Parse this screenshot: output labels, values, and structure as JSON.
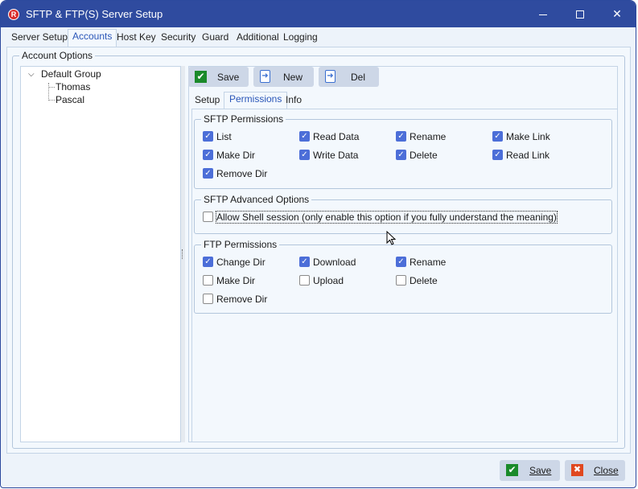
{
  "window": {
    "title": "SFTP & FTP(S) Server Setup",
    "app_icon_letter": "R",
    "controls": {
      "minimize": "",
      "maximize": "",
      "close": "✕"
    }
  },
  "tabs": [
    {
      "label": "Server Setup",
      "active": false
    },
    {
      "label": "Accounts",
      "active": true
    },
    {
      "label": "Host Key",
      "active": false
    },
    {
      "label": "Security",
      "active": false
    },
    {
      "label": "Guard",
      "active": false
    },
    {
      "label": "Additional",
      "active": false
    },
    {
      "label": "Logging",
      "active": false
    }
  ],
  "account_options": {
    "title": "Account Options",
    "tree": {
      "group": "Default Group",
      "chevron": "⌵",
      "users": [
        "Thomas",
        "Pascal"
      ]
    },
    "toolbar": {
      "save_label": "Save",
      "new_label": "New",
      "del_label": "Del",
      "check_glyph": "✔",
      "arrow_glyph": "➜"
    },
    "subtabs": [
      {
        "label": "Setup",
        "active": false
      },
      {
        "label": "Permissions",
        "active": true
      },
      {
        "label": "Info",
        "active": false
      }
    ],
    "sftp_permissions": {
      "title": "SFTP Permissions",
      "items": [
        {
          "label": "List",
          "checked": true
        },
        {
          "label": "Read Data",
          "checked": true
        },
        {
          "label": "Rename",
          "checked": true
        },
        {
          "label": "Make Link",
          "checked": true
        },
        {
          "label": "Make Dir",
          "checked": true
        },
        {
          "label": "Write Data",
          "checked": true
        },
        {
          "label": "Delete",
          "checked": true
        },
        {
          "label": "Read Link",
          "checked": true
        },
        {
          "label": "Remove Dir",
          "checked": true
        }
      ]
    },
    "sftp_advanced": {
      "title": "SFTP Advanced Options",
      "allow_shell": {
        "label": "Allow Shell session (only enable this option if you fully understand the meaning)",
        "checked": false
      }
    },
    "ftp_permissions": {
      "title": "FTP Permissions",
      "items": [
        {
          "label": "Change Dir",
          "checked": true
        },
        {
          "label": "Download",
          "checked": true
        },
        {
          "label": "Rename",
          "checked": true
        },
        {
          "label": "Make Dir",
          "checked": false
        },
        {
          "label": "Upload",
          "checked": false
        },
        {
          "label": "Delete",
          "checked": false
        },
        {
          "label": "Remove Dir",
          "checked": false
        }
      ]
    }
  },
  "footer": {
    "save_label": "Save",
    "close_label": "Close",
    "check_glyph": "✔",
    "close_glyph": "✖"
  },
  "check_mark": "✓"
}
